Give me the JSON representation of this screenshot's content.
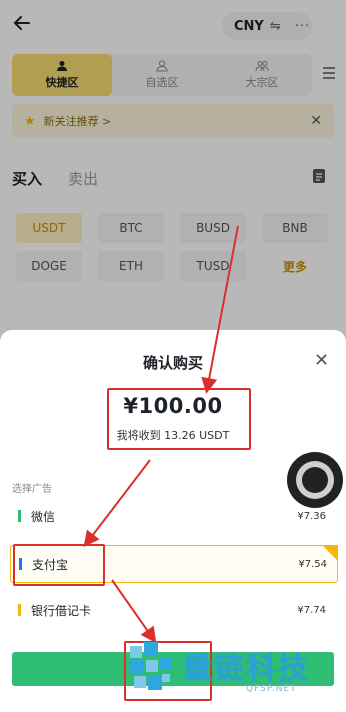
{
  "header": {
    "currency": "CNY",
    "swap_glyph": "⇋",
    "more_glyph": "···"
  },
  "mode_tabs": [
    {
      "label": "快捷区",
      "icon": "people-icon",
      "active": true
    },
    {
      "label": "自选区",
      "icon": "star-people-icon",
      "active": false
    },
    {
      "label": "大宗区",
      "icon": "bulk-people-icon",
      "active": false
    }
  ],
  "banner": {
    "text": "新关注推荐 >"
  },
  "trade_tabs": {
    "buy": "买入",
    "sell": "卖出"
  },
  "coins": [
    "USDT",
    "BTC",
    "BUSD",
    "BNB",
    "DOGE",
    "ETH",
    "TUSD",
    "更多"
  ],
  "sheet": {
    "title": "确认购买",
    "price": "¥100.00",
    "receive": "我将收到 13.26 USDT",
    "select_label": "选择广告",
    "payments": [
      {
        "name": "微信",
        "price": "¥7.36",
        "color": "#2ebd72"
      },
      {
        "name": "支付宝",
        "price": "¥7.54",
        "color": "#1677ff"
      },
      {
        "name": "银行借记卡",
        "price": "¥7.74",
        "color": "#f0b90b"
      }
    ]
  },
  "watermark": {
    "title": "量链科技",
    "site": "QFSP.NET"
  },
  "colors": {
    "accent": "#f0b90b",
    "buy": "#2ebd72",
    "annotation": "#d9302c"
  }
}
